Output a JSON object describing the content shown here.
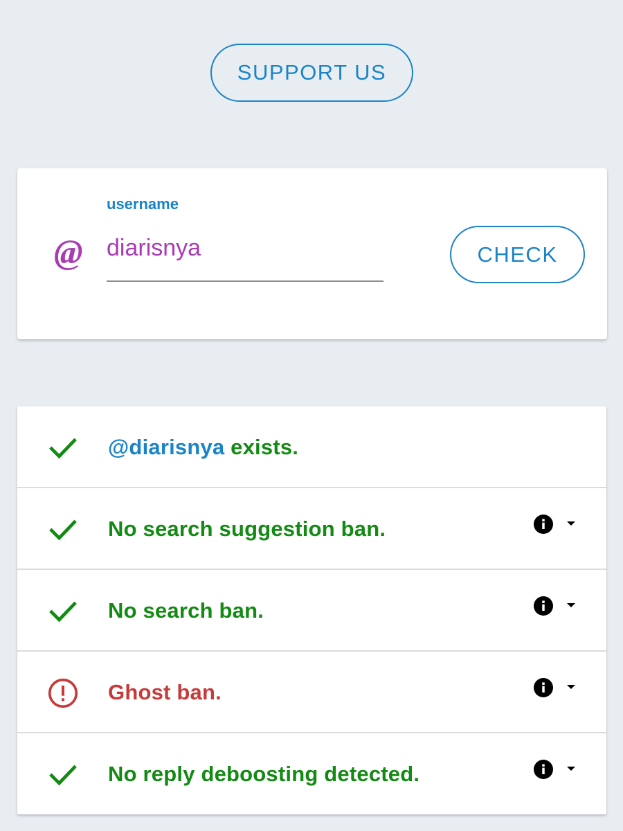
{
  "support_button": {
    "label": "SUPPORT US"
  },
  "username_form": {
    "label": "username",
    "value": "diarisnya",
    "at_symbol": "@",
    "check_label": "CHECK"
  },
  "results": [
    {
      "icon": "check-icon",
      "status": "ok",
      "prefix": "@diarisnya",
      "text": " exists.",
      "has_details": false
    },
    {
      "icon": "check-icon",
      "status": "ok",
      "text": "No search suggestion ban.",
      "has_details": true
    },
    {
      "icon": "check-icon",
      "status": "ok",
      "text": "No search ban.",
      "has_details": true
    },
    {
      "icon": "alert-circle-icon",
      "status": "bad",
      "text": "Ghost ban.",
      "has_details": true
    },
    {
      "icon": "check-icon",
      "status": "ok",
      "text": "No reply deboosting detected.",
      "has_details": true
    }
  ],
  "colors": {
    "background": "#e8edf2",
    "accent": "#1b84c6",
    "username": "#a93bb3",
    "ok": "#138a13",
    "bad": "#c63a3a"
  }
}
